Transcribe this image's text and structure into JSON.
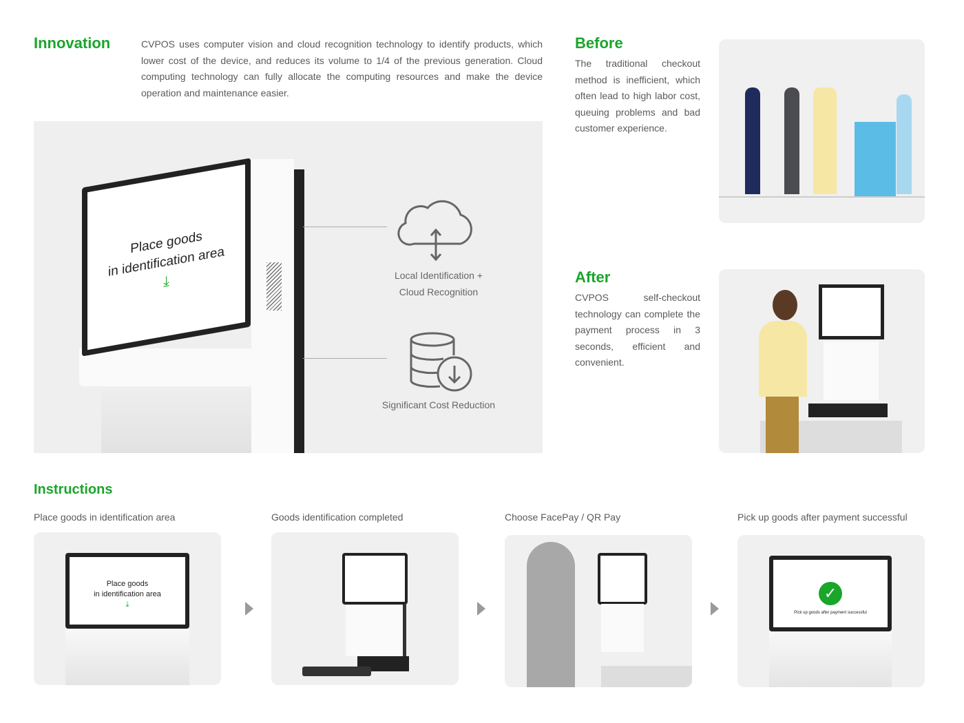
{
  "innovation": {
    "title": "Innovation",
    "text": "CVPOS uses computer vision and cloud recognition technology to identify products, which lower cost of the device, and reduces its volume to 1/4 of the previous generation. Cloud computing technology can fully allocate the computing resources and make the device operation and maintenance easier."
  },
  "hero": {
    "screen_line1": "Place goods",
    "screen_line2": "in identification area",
    "features": [
      {
        "icon": "cloud-sync-icon",
        "line1": "Local Identification +",
        "line2": "Cloud Recognition"
      },
      {
        "icon": "database-download-icon",
        "line1": "Significant Cost Reduction"
      }
    ]
  },
  "before": {
    "title": "Before",
    "text": "The traditional checkout method is inefficient, which often lead to high labor cost, queuing problems and bad customer experience."
  },
  "after": {
    "title": "After",
    "text": "CVPOS self-checkout technology can complete the payment process in 3 seconds, efficient and convenient."
  },
  "instructions": {
    "title": "Instructions",
    "steps": [
      {
        "caption": "Place goods in identification area",
        "screen_line1": "Place goods",
        "screen_line2": "in identification area"
      },
      {
        "caption": "Goods identification completed"
      },
      {
        "caption": "Choose FacePay / QR Pay"
      },
      {
        "caption": "Pick up goods after payment successful",
        "screen_text": "Pick up goods after payment successful"
      }
    ]
  },
  "colors": {
    "accent": "#1aa52b",
    "panel": "#efefef"
  }
}
